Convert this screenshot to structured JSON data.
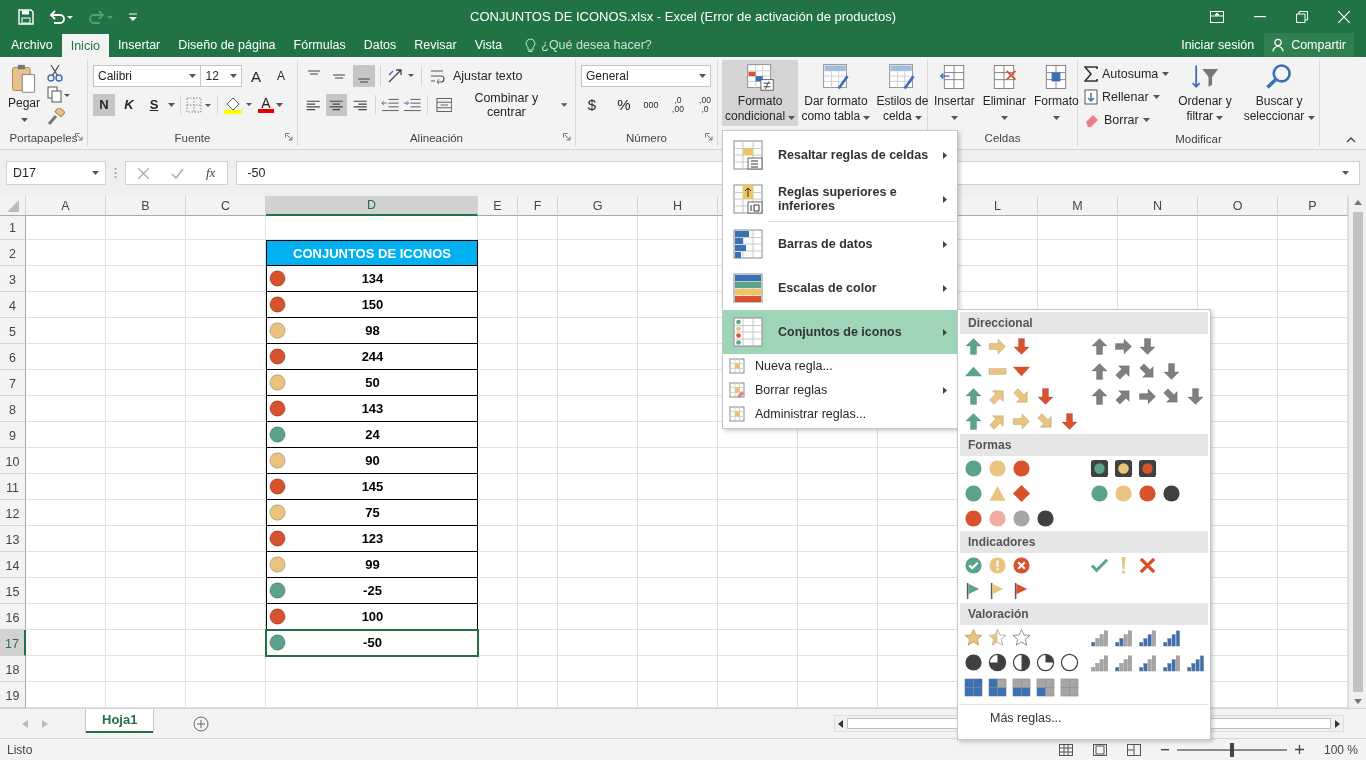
{
  "title_bar": {
    "title": "CONJUNTOS DE ICONOS.xlsx - Excel (Error de activación de productos)"
  },
  "menu_tabs": [
    {
      "label": "Archivo",
      "selected": false
    },
    {
      "label": "Inicio",
      "selected": true
    },
    {
      "label": "Insertar",
      "selected": false
    },
    {
      "label": "Diseño de página",
      "selected": false
    },
    {
      "label": "Fórmulas",
      "selected": false
    },
    {
      "label": "Datos",
      "selected": false
    },
    {
      "label": "Revisar",
      "selected": false
    },
    {
      "label": "Vista",
      "selected": false
    }
  ],
  "tell_me": {
    "placeholder": "¿Qué desea hacer?"
  },
  "account": {
    "sign_in": "Iniciar sesión",
    "share": "Compartir"
  },
  "ribbon": {
    "clipboard": {
      "paste": "Pegar",
      "label": "Portapapeles"
    },
    "font": {
      "family": "Calibri",
      "size": "12",
      "grow": "A",
      "shrink": "A",
      "styles": [
        {
          "label": "N",
          "on": true
        },
        {
          "label": "K",
          "on": false
        },
        {
          "label": "S",
          "on": false
        }
      ],
      "font_color": "A",
      "label": "Fuente"
    },
    "alignment": {
      "vertical": [
        {
          "on": false
        },
        {
          "on": false
        },
        {
          "on": true
        }
      ],
      "horizontal": [
        {
          "on": false
        },
        {
          "on": true
        },
        {
          "on": false
        }
      ],
      "wrap": "Ajustar texto",
      "merge": "Combinar y centrar",
      "label": "Alineación"
    },
    "number": {
      "format": "General",
      "currency": "$",
      "percent": "%",
      "thousands": "000",
      "decimals": [
        {
          "top": ",0",
          "bottom": ",00"
        },
        {
          "top": ",00",
          "bottom": ",0"
        }
      ],
      "label": "Número"
    },
    "styles": {
      "buttons": [
        {
          "lines": [
            "Formato",
            "condicional"
          ],
          "selected": true
        },
        {
          "lines": [
            "Dar formato",
            "como tabla"
          ],
          "selected": false
        },
        {
          "lines": [
            "Estilos de",
            "celda"
          ],
          "selected": false
        }
      ]
    },
    "cells": {
      "buttons": [
        "Insertar",
        "Eliminar",
        "Formato"
      ],
      "label": "Celdas"
    },
    "editing": {
      "small": [
        "Autosuma",
        "Rellenar",
        "Borrar"
      ],
      "big": [
        {
          "lines": [
            "Ordenar y",
            "filtrar"
          ]
        },
        {
          "lines": [
            "Buscar y",
            "seleccionar"
          ]
        }
      ],
      "label": "Modificar"
    }
  },
  "formula_bar": {
    "name_box": "D17",
    "function_label": "fx",
    "value": "-50"
  },
  "columns": [
    "A",
    "B",
    "C",
    "D",
    "E",
    "F",
    "G",
    "H",
    "L",
    "M",
    "N",
    "O",
    "P"
  ],
  "rows": [
    "1",
    "2",
    "3",
    "4",
    "5",
    "6",
    "7",
    "8",
    "9",
    "10",
    "11",
    "12",
    "13",
    "14",
    "15",
    "16",
    "17",
    "18",
    "19"
  ],
  "table": {
    "header": "CONJUNTOS DE ICONOS",
    "rows": [
      {
        "value": "134",
        "color": "#d6532d",
        "selected": false
      },
      {
        "value": "150",
        "color": "#d6532d",
        "selected": false
      },
      {
        "value": "98",
        "color": "#eac47e",
        "selected": false
      },
      {
        "value": "244",
        "color": "#d6532d",
        "selected": false
      },
      {
        "value": "50",
        "color": "#eac47e",
        "selected": false
      },
      {
        "value": "143",
        "color": "#d6532d",
        "selected": false
      },
      {
        "value": "24",
        "color": "#5ba38d",
        "selected": false
      },
      {
        "value": "90",
        "color": "#eac47e",
        "selected": false
      },
      {
        "value": "145",
        "color": "#d6532d",
        "selected": false
      },
      {
        "value": "75",
        "color": "#eac47e",
        "selected": false
      },
      {
        "value": "123",
        "color": "#d6532d",
        "selected": false
      },
      {
        "value": "99",
        "color": "#eac47e",
        "selected": false
      },
      {
        "value": "-25",
        "color": "#5ba38d",
        "selected": false
      },
      {
        "value": "100",
        "color": "#d6532d",
        "selected": false
      },
      {
        "value": "-50",
        "color": "#5ba38d",
        "selected": true
      }
    ]
  },
  "cf_menu": {
    "items": [
      {
        "label": "Resaltar reglas de celdas",
        "kind": "large",
        "submenu": true,
        "selected": false
      },
      {
        "label": "Reglas superiores e inferiores",
        "kind": "large",
        "submenu": true,
        "selected": false
      },
      {
        "label": "Barras de datos",
        "kind": "large",
        "submenu": true,
        "selected": false
      },
      {
        "label": "Escalas de color",
        "kind": "large",
        "submenu": true,
        "selected": false
      },
      {
        "label": "Conjuntos de iconos",
        "kind": "large",
        "submenu": true,
        "selected": true
      },
      {
        "label": "Nueva regla...",
        "kind": "small",
        "submenu": false,
        "selected": false
      },
      {
        "label": "Borrar reglas",
        "kind": "small",
        "submenu": true,
        "selected": false
      },
      {
        "label": "Administrar reglas...",
        "kind": "small",
        "submenu": false,
        "selected": false
      }
    ]
  },
  "icon_sets_menu": {
    "sections": [
      {
        "title": "Direccional",
        "rows": [
          {
            "left": [
              {
                "kind": "up",
                "color": "#5ba38d"
              },
              {
                "kind": "right",
                "color": "#eac47e"
              },
              {
                "kind": "down",
                "color": "#d6532d"
              }
            ],
            "right": [
              {
                "kind": "up",
                "color": "#7f7f7f"
              },
              {
                "kind": "right",
                "color": "#7f7f7f"
              },
              {
                "kind": "down",
                "color": "#7f7f7f"
              }
            ]
          },
          {
            "left": [
              {
                "kind": "tri-up",
                "color": "#5ba38d"
              },
              {
                "kind": "dash",
                "color": "#eac47e"
              },
              {
                "kind": "tri-down",
                "color": "#d6532d"
              }
            ],
            "right": [
              {
                "kind": "up",
                "color": "#7f7f7f"
              },
              {
                "kind": "ne",
                "color": "#7f7f7f"
              },
              {
                "kind": "se",
                "color": "#7f7f7f"
              },
              {
                "kind": "down",
                "color": "#7f7f7f"
              }
            ]
          },
          {
            "left": [
              {
                "kind": "up",
                "color": "#5ba38d"
              },
              {
                "kind": "ne",
                "color": "#eac47e"
              },
              {
                "kind": "se",
                "color": "#eac47e"
              },
              {
                "kind": "down",
                "color": "#d6532d"
              }
            ],
            "right": [
              {
                "kind": "up",
                "color": "#7f7f7f"
              },
              {
                "kind": "ne",
                "color": "#7f7f7f"
              },
              {
                "kind": "right",
                "color": "#7f7f7f"
              },
              {
                "kind": "se",
                "color": "#7f7f7f"
              },
              {
                "kind": "down",
                "color": "#7f7f7f"
              }
            ]
          },
          {
            "left": [
              {
                "kind": "up",
                "color": "#5ba38d"
              },
              {
                "kind": "ne",
                "color": "#eac47e"
              },
              {
                "kind": "right",
                "color": "#eac47e"
              },
              {
                "kind": "se",
                "color": "#eac47e"
              },
              {
                "kind": "down",
                "color": "#d6532d"
              }
            ]
          }
        ]
      },
      {
        "title": "Formas",
        "rows": [
          {
            "left": [
              {
                "kind": "circle",
                "color": "#5ba38d"
              },
              {
                "kind": "circle",
                "color": "#eac47e"
              },
              {
                "kind": "circle",
                "color": "#d6532d"
              }
            ],
            "right": [
              {
                "kind": "light",
                "color": "#5ba38d"
              },
              {
                "kind": "light",
                "color": "#eac47e"
              },
              {
                "kind": "light",
                "color": "#d6532d"
              }
            ]
          },
          {
            "left": [
              {
                "kind": "circle",
                "color": "#5ba38d"
              },
              {
                "kind": "triangle",
                "color": "#eac47e"
              },
              {
                "kind": "diamond",
                "color": "#d6532d"
              }
            ],
            "right": [
              {
                "kind": "circle",
                "color": "#5ba38d"
              },
              {
                "kind": "circle",
                "color": "#eac47e"
              },
              {
                "kind": "circle",
                "color": "#d6532d"
              },
              {
                "kind": "circle",
                "color": "#404040"
              }
            ]
          },
          {
            "left": [
              {
                "kind": "circle",
                "color": "#d6532d"
              },
              {
                "kind": "circle",
                "color": "#f0aca0"
              },
              {
                "kind": "circle",
                "color": "#a6a6a6"
              },
              {
                "kind": "circle",
                "color": "#404040"
              }
            ]
          }
        ]
      },
      {
        "title": "Indicadores",
        "rows": [
          {
            "left": [
              {
                "kind": "check-circle",
                "color": "#5ba38d"
              },
              {
                "kind": "excl-circle",
                "color": "#eac47e"
              },
              {
                "kind": "x-circle",
                "color": "#d6532d"
              }
            ],
            "right": [
              {
                "kind": "check",
                "color": "#5ba38d"
              },
              {
                "kind": "excl",
                "color": "#eac47e"
              },
              {
                "kind": "x",
                "color": "#d6532d"
              }
            ]
          },
          {
            "left": [
              {
                "kind": "flag",
                "color": "#5ba38d"
              },
              {
                "kind": "flag",
                "color": "#eac47e"
              },
              {
                "kind": "flag",
                "color": "#d6532d"
              }
            ]
          }
        ]
      },
      {
        "title": "Valoración",
        "rows": [
          {
            "left": [
              {
                "kind": "star-full"
              },
              {
                "kind": "star-half"
              },
              {
                "kind": "star-empty"
              }
            ],
            "right": [
              {
                "kind": "bars-1"
              },
              {
                "kind": "bars-2"
              },
              {
                "kind": "bars-3"
              },
              {
                "kind": "bars-4"
              }
            ]
          },
          {
            "left": [
              {
                "kind": "pie-4"
              },
              {
                "kind": "pie-3"
              },
              {
                "kind": "pie-2"
              },
              {
                "kind": "pie-1"
              },
              {
                "kind": "pie-0"
              }
            ],
            "right": [
              {
                "kind": "bars-0"
              },
              {
                "kind": "bars-1"
              },
              {
                "kind": "bars-2"
              },
              {
                "kind": "bars-3"
              },
              {
                "kind": "bars-4"
              }
            ]
          },
          {
            "left": [
              {
                "kind": "quad-4"
              },
              {
                "kind": "quad-3"
              },
              {
                "kind": "quad-2"
              },
              {
                "kind": "quad-1"
              },
              {
                "kind": "quad-0"
              }
            ]
          }
        ]
      }
    ],
    "more": "Más reglas..."
  },
  "sheet_tabs": [
    {
      "label": "Hoja1",
      "selected": true
    }
  ],
  "status_bar": {
    "status": "Listo",
    "zoom_slider": {
      "level": 0.5
    },
    "zoom": "100 %"
  }
}
